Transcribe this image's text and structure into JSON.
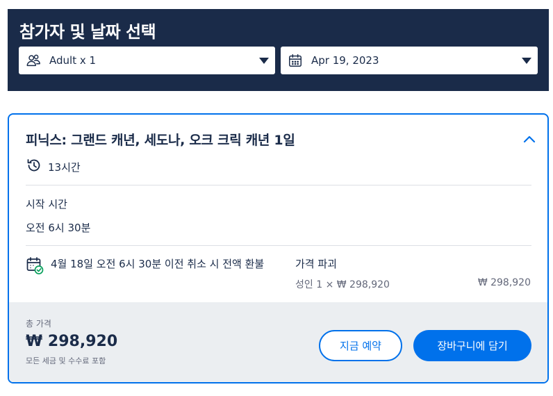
{
  "header": {
    "title": "참가자 및 날짜 선택",
    "participants_value": "Adult x 1",
    "date_value": "Apr 19, 2023"
  },
  "option": {
    "title": "피닉스: 그랜드 캐년, 세도나, 오크 크릭 캐년 1일",
    "duration": "13시간",
    "start_time_label": "시작 시간",
    "start_time_value": "오전 6시 30분",
    "cancellation": "4월 18일 오전 6시 30분 이전 취소 시 전액 환불",
    "price_breakdown_label": "가격 파괴",
    "price_line": "성인 1 × ₩ 298,920",
    "price_line_amount": "₩ 298,920"
  },
  "footer": {
    "total_label": "총 가격",
    "total_amount": "₩ 298,920",
    "tax_note": "모든 세금 및 수수료 포함",
    "book_now_label": "지금 예약",
    "add_to_cart_label": "장바구니에 담기"
  },
  "colors": {
    "header_bg": "#1a2b49",
    "accent": "#0071eb",
    "footer_bg": "#ebeef1",
    "check_green": "#08a05c"
  },
  "icons": {
    "participants": "people-icon",
    "date": "calendar-icon",
    "duration": "clock-history-icon",
    "cancellation": "calendar-check-icon",
    "collapse": "chevron-up-icon"
  }
}
